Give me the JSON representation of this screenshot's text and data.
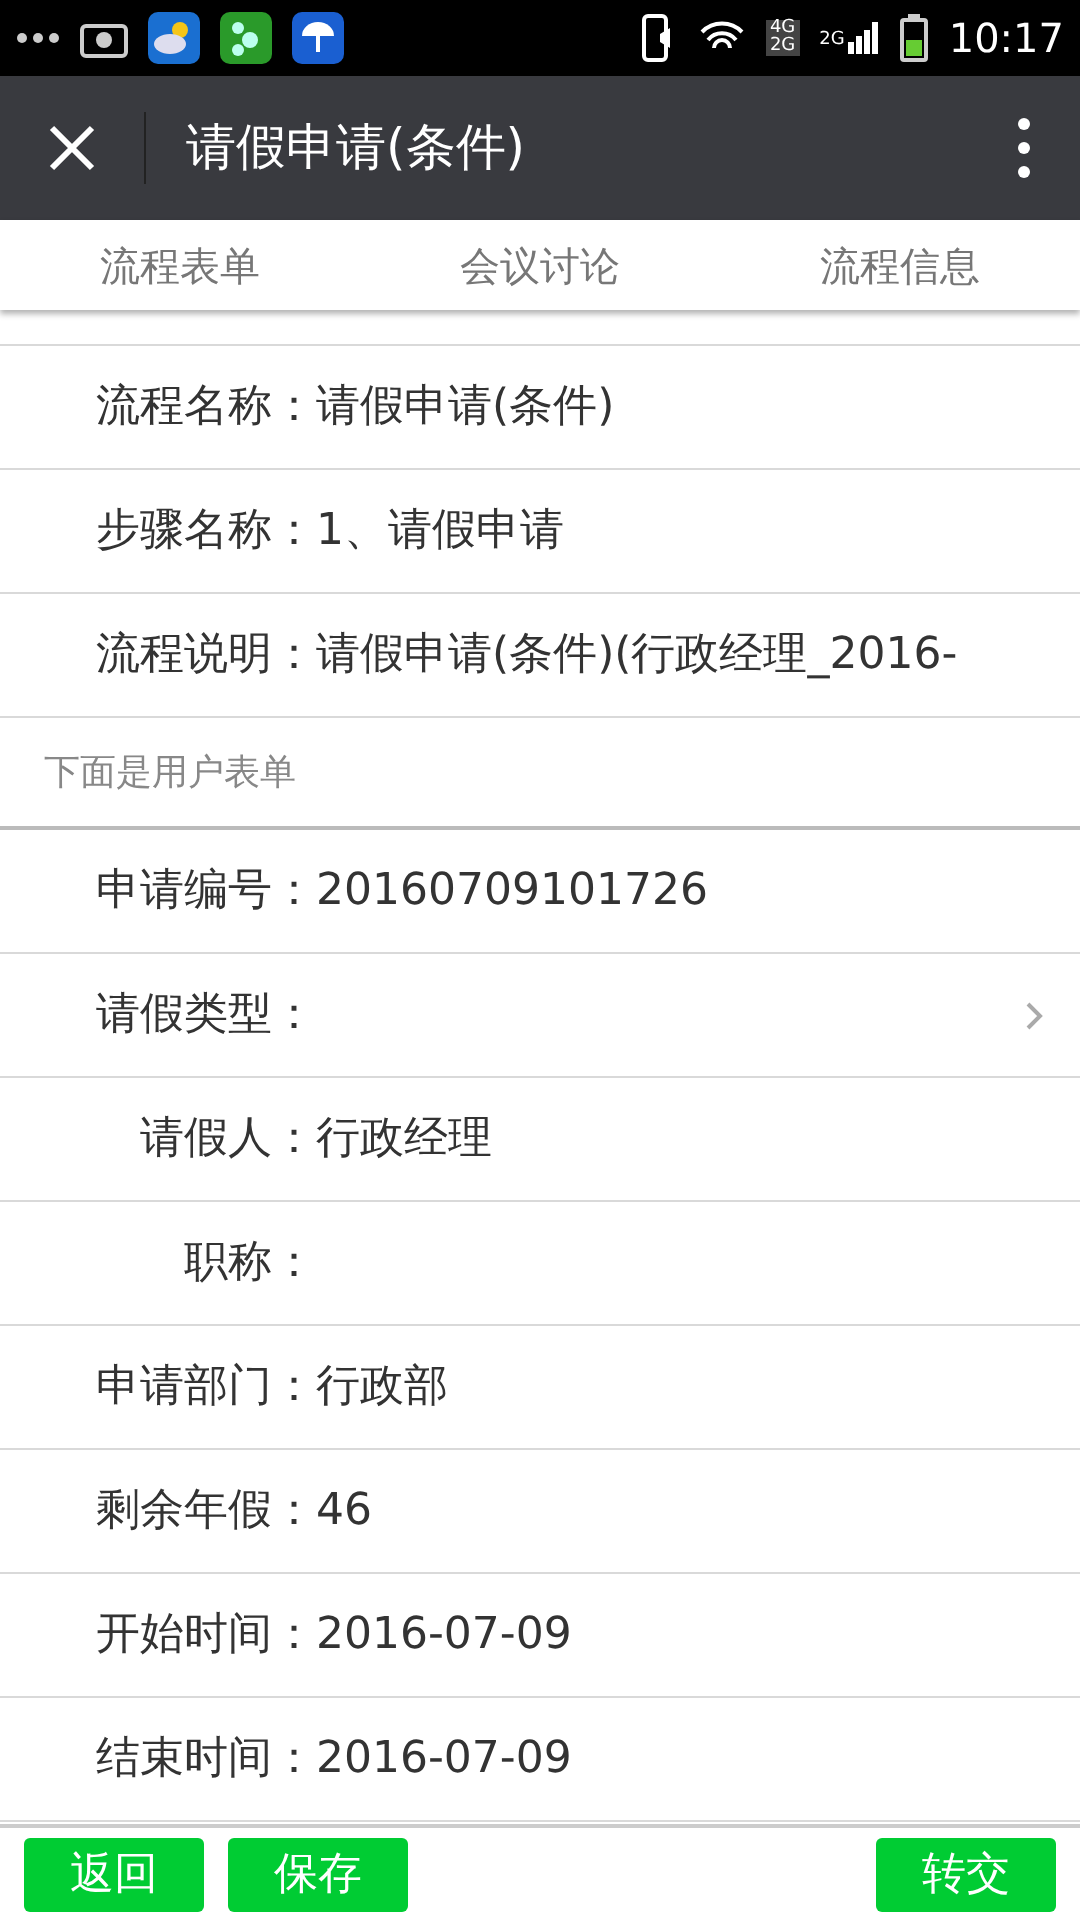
{
  "status_bar": {
    "network_top": "4G",
    "network_bottom": "2G",
    "network_second": "2G",
    "time": "10:17"
  },
  "header": {
    "title": "请假申请(条件)"
  },
  "tabs": [
    {
      "label": "流程表单"
    },
    {
      "label": "会议讨论"
    },
    {
      "label": "流程信息"
    }
  ],
  "flow_info": [
    {
      "label": "流程名称：",
      "value": "请假申请(条件)"
    },
    {
      "label": "步骤名称：",
      "value": "1、请假申请"
    },
    {
      "label": "流程说明：",
      "value": "请假申请(条件)(行政经理_2016-"
    }
  ],
  "section_title": "下面是用户表单",
  "form_rows": [
    {
      "kind": "text",
      "label": "申请编号：",
      "value": "20160709101726"
    },
    {
      "kind": "select",
      "label": "请假类型："
    },
    {
      "kind": "text",
      "label": "请假人：",
      "value": "行政经理"
    },
    {
      "kind": "text",
      "label": "职称："
    },
    {
      "kind": "text",
      "label": "申请部门：",
      "value": "行政部"
    },
    {
      "kind": "text",
      "label": "剩余年假：",
      "value": "46"
    },
    {
      "kind": "text",
      "label": "开始时间：",
      "value": "2016-07-09"
    },
    {
      "kind": "text",
      "label": "结束时间：",
      "value": "2016-07-09"
    }
  ],
  "buttons": [
    "返回",
    "保存",
    "转交"
  ]
}
